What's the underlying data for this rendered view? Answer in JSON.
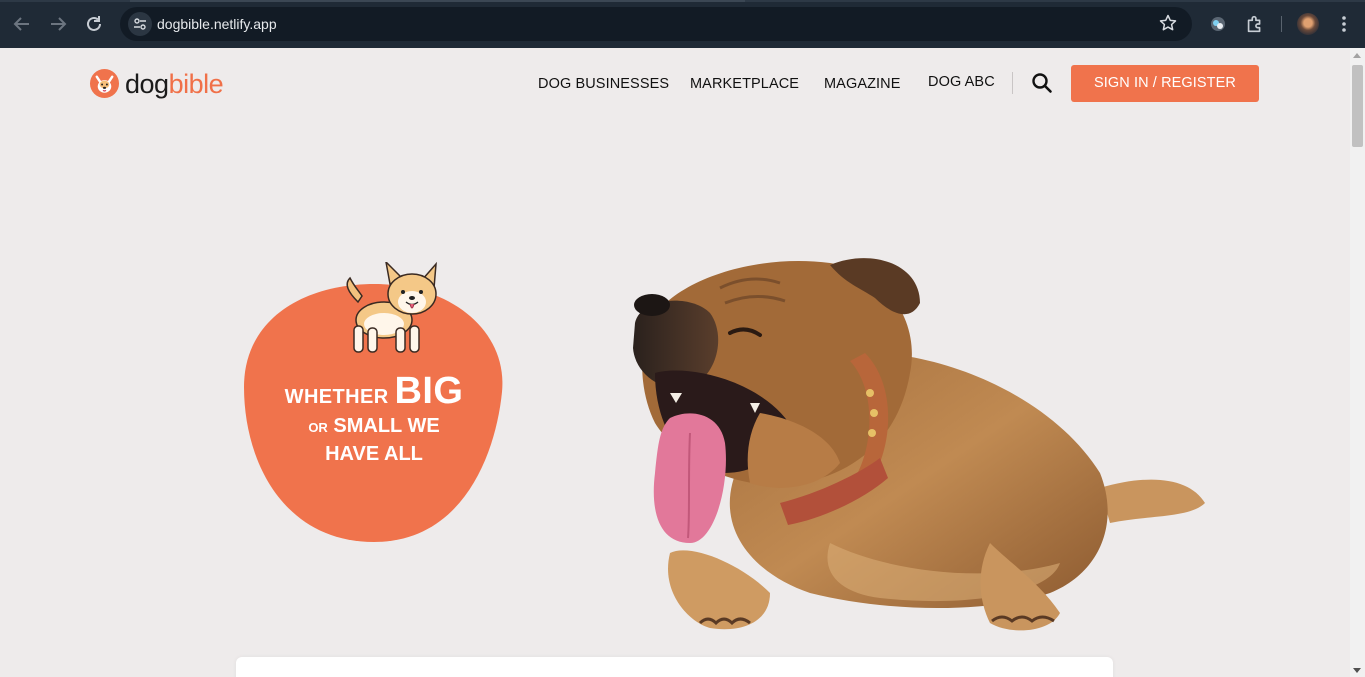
{
  "browser": {
    "url": "dogbible.netlify.app",
    "back_icon": "arrow-left-icon",
    "forward_icon": "arrow-right-icon",
    "reload_icon": "reload-icon",
    "bookmark_icon": "star-icon",
    "menu_icon": "kebab-menu-icon"
  },
  "header": {
    "logo_part1": "dog",
    "logo_part2": "bible",
    "nav": [
      {
        "label": "DOG BUSINESSES"
      },
      {
        "label": "MARKETPLACE"
      },
      {
        "label": "MAGAZINE"
      },
      {
        "label": "DOG ABC"
      }
    ],
    "cta_label": "SIGN IN / REGISTER"
  },
  "hero": {
    "line1_small": "WHETHER",
    "line1_big": "BIG",
    "line2_small": "OR",
    "line2_rest": "SMALL WE",
    "line3": "HAVE ALL"
  },
  "colors": {
    "brand": "#f0734c",
    "page_bg": "#eeebeb",
    "chrome_bg": "#1f2a36"
  }
}
